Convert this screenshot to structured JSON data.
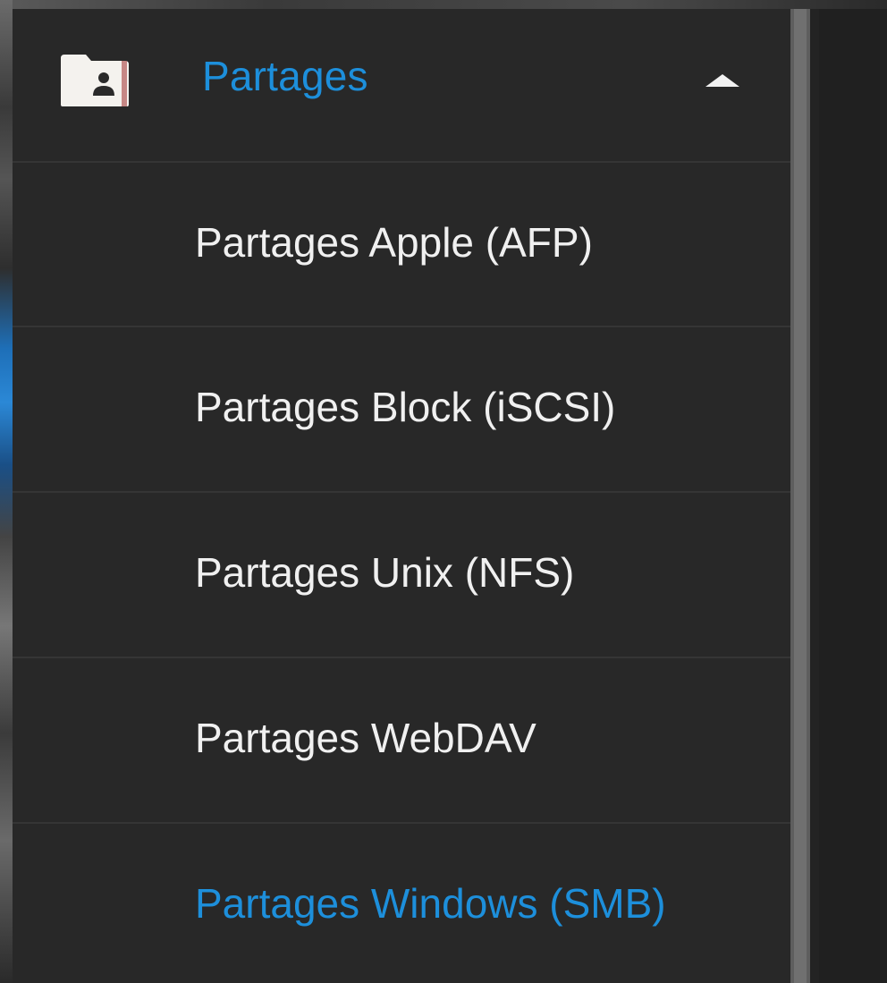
{
  "menu": {
    "header": {
      "label": "Partages",
      "icon": "folder-shared-icon",
      "expand_icon": "caret-up-icon",
      "expanded": true,
      "accent_color": "#1d8fdb"
    },
    "items": [
      {
        "label": "Partages Apple (AFP)",
        "active": false
      },
      {
        "label": "Partages Block (iSCSI)",
        "active": false
      },
      {
        "label": "Partages Unix (NFS)",
        "active": false
      },
      {
        "label": "Partages WebDAV",
        "active": false
      },
      {
        "label": "Partages Windows (SMB)",
        "active": true
      }
    ]
  },
  "colors": {
    "background": "#282828",
    "text": "#f0f0f0",
    "active": "#1d8fdb",
    "divider": "#353535"
  }
}
